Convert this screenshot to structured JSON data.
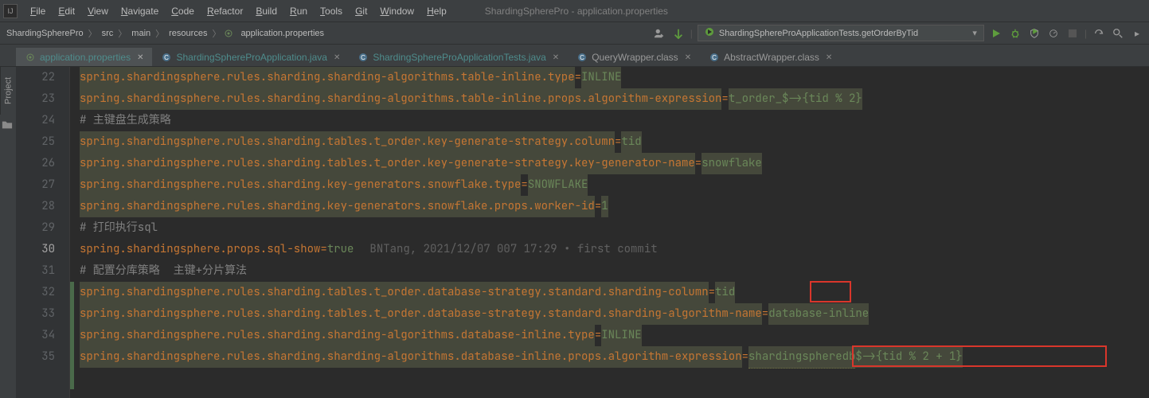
{
  "window": {
    "title": "ShardingSpherePro - application.properties"
  },
  "menu": [
    "File",
    "Edit",
    "View",
    "Navigate",
    "Code",
    "Refactor",
    "Build",
    "Run",
    "Tools",
    "Git",
    "Window",
    "Help"
  ],
  "breadcrumbs": [
    "ShardingSpherePro",
    "src",
    "main",
    "resources",
    "application.properties"
  ],
  "run_config": "ShardingSphereProApplicationTests.getOrderByTid",
  "tabs": [
    {
      "name": "application.properties",
      "active": true,
      "type": "prop"
    },
    {
      "name": "ShardingSphereProApplication.java",
      "active": false,
      "type": "java"
    },
    {
      "name": "ShardingSphereProApplicationTests.java",
      "active": false,
      "type": "java"
    },
    {
      "name": "QueryWrapper.class",
      "active": false,
      "type": "class"
    },
    {
      "name": "AbstractWrapper.class",
      "active": false,
      "type": "class"
    }
  ],
  "side_tab": "Project",
  "lines": [
    {
      "n": 22,
      "key": "spring.shardingsphere.rules.sharding.sharding-algorithms.table-inline.type",
      "eq": "=",
      "val": "INLINE",
      "vhl": true
    },
    {
      "n": 23,
      "key": "spring.shardingsphere.rules.sharding.sharding-algorithms.table-inline.props.algorithm-expression",
      "eq": "=",
      "val": "t_order_$->{tid % 2}",
      "vhl": true
    },
    {
      "n": 24,
      "comment": "# 主键盘生成策略"
    },
    {
      "n": 25,
      "key": "spring.shardingsphere.rules.sharding.tables.t_order.key-generate-strategy.column",
      "eq": "=",
      "val": "tid",
      "vhl": true
    },
    {
      "n": 26,
      "key": "spring.shardingsphere.rules.sharding.tables.t_order.key-generate-strategy.key-generator-name",
      "eq": "=",
      "val": "snowflake",
      "vhl": true
    },
    {
      "n": 27,
      "key": "spring.shardingsphere.rules.sharding.key-generators.snowflake.type",
      "eq": "=",
      "val": "SNOWFLAKE",
      "vhl": true
    },
    {
      "n": 28,
      "key": "spring.shardingsphere.rules.sharding.key-generators.snowflake.props.worker-id",
      "eq": "=",
      "val": "1",
      "vhl": true
    },
    {
      "n": 29,
      "comment": "# 打印执行sql"
    },
    {
      "n": 30,
      "key": "spring.shardingsphere.props.sql-show",
      "eq": "=",
      "val": "true",
      "nohl": true,
      "author": "BNTang, 2021/12/07 007 17:29 • first commit",
      "cur": true
    },
    {
      "n": 31,
      "comment": "# 配置分库策略  主键+分片算法"
    },
    {
      "n": 32,
      "key": "spring.shardingsphere.rules.sharding.tables.t_order.database-strategy.standard.sharding-column",
      "eq": "=",
      "val": "tid",
      "vhl": true
    },
    {
      "n": 33,
      "key": "spring.shardingsphere.rules.sharding.tables.t_order.database-strategy.standard.sharding-algorithm-name",
      "eq": "=",
      "val": "database-inline",
      "vhl": true
    },
    {
      "n": 34,
      "key": "spring.shardingsphere.rules.sharding.sharding-algorithms.database-inline.type",
      "eq": "=",
      "val": "INLINE",
      "vhl": true
    },
    {
      "n": 35,
      "key": "spring.shardingsphere.rules.sharding.sharding-algorithms.database-inline.props.algorithm-expression",
      "eq": "=",
      "val_pre": "shardingspheredb",
      "val_post": "$->{tid % 2 + 1}",
      "vhl": true
    }
  ]
}
